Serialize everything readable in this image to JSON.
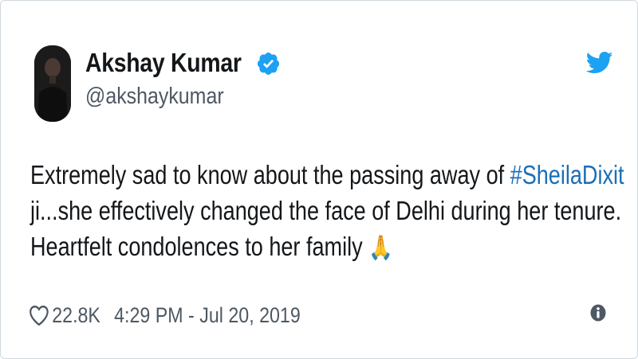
{
  "user": {
    "display_name": "Akshay Kumar",
    "username": "@akshaykumar",
    "verified": true,
    "avatar": "profile-photo"
  },
  "tweet": {
    "line1_text": "Extremely sad to know about the passing away of ",
    "hashtag": "#SheilaDixit",
    "line2_text": "ji...she effectively changed the face of Delhi during her tenure.",
    "line3_text": "Heartfelt condolences to her family ",
    "emoji": "🙏"
  },
  "footer": {
    "like_count": "22.8K",
    "timestamp": "4:29 PM - Jul 20, 2019"
  },
  "icons": {
    "brand": "twitter-bird-icon",
    "like": "heart-icon",
    "info": "info-icon",
    "verified": "verified-badge-icon"
  },
  "colors": {
    "twitter_blue": "#1da1f2",
    "hashtag": "#1b6fb6",
    "text": "#14171a",
    "secondary_text": "#4d5863"
  }
}
